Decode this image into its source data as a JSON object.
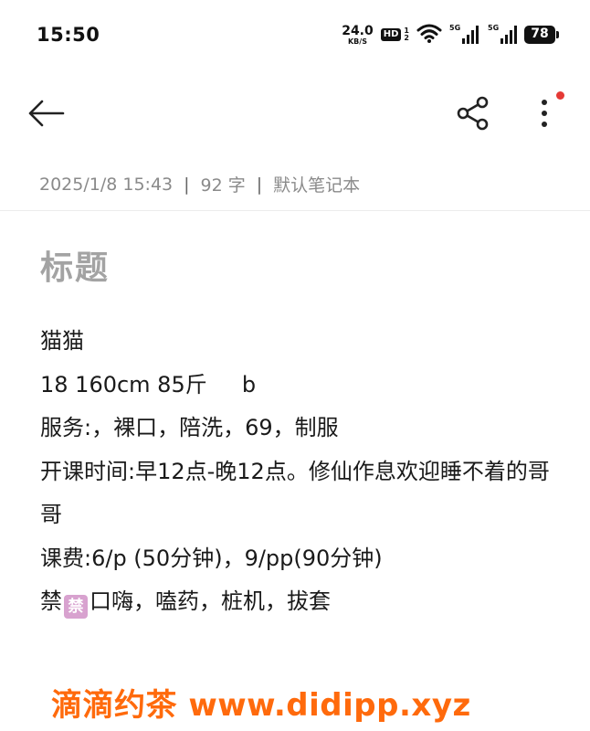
{
  "status_bar": {
    "time": "15:50",
    "net_speed_value": "24.0",
    "net_speed_unit": "KB/S",
    "hd_badge": "HD",
    "hd_sub_top": "1",
    "hd_sub_bottom": "2",
    "signal_1_label": "5G",
    "signal_2_label": "5G",
    "battery": "78"
  },
  "toolbar": {
    "back_icon": "arrow-left-icon",
    "share_icon": "share-icon",
    "more_icon": "more-vertical-icon",
    "badge_color": "#e53935"
  },
  "meta": {
    "date": "2025/1/8 15:43",
    "separator": "|",
    "word_count": "92 字",
    "notebook": "默认笔记本"
  },
  "note": {
    "title": "标题",
    "lines": [
      "猫猫",
      "18 160cm 85斤     b",
      "服务:，裸口，陪洗，69，制服",
      "开课时间:早12点-晚12点。修仙作息欢迎睡不着的哥哥",
      "课费:6/p (50分钟)，9/pp(90分钟)"
    ],
    "last_line_prefix": "禁",
    "last_line_emoji": "禁",
    "last_line_suffix": "口嗨，嗑药，桩机，拔套"
  },
  "watermark": {
    "text": "滴滴约茶 www.didipp.xyz",
    "color": "#ff6a0c"
  }
}
